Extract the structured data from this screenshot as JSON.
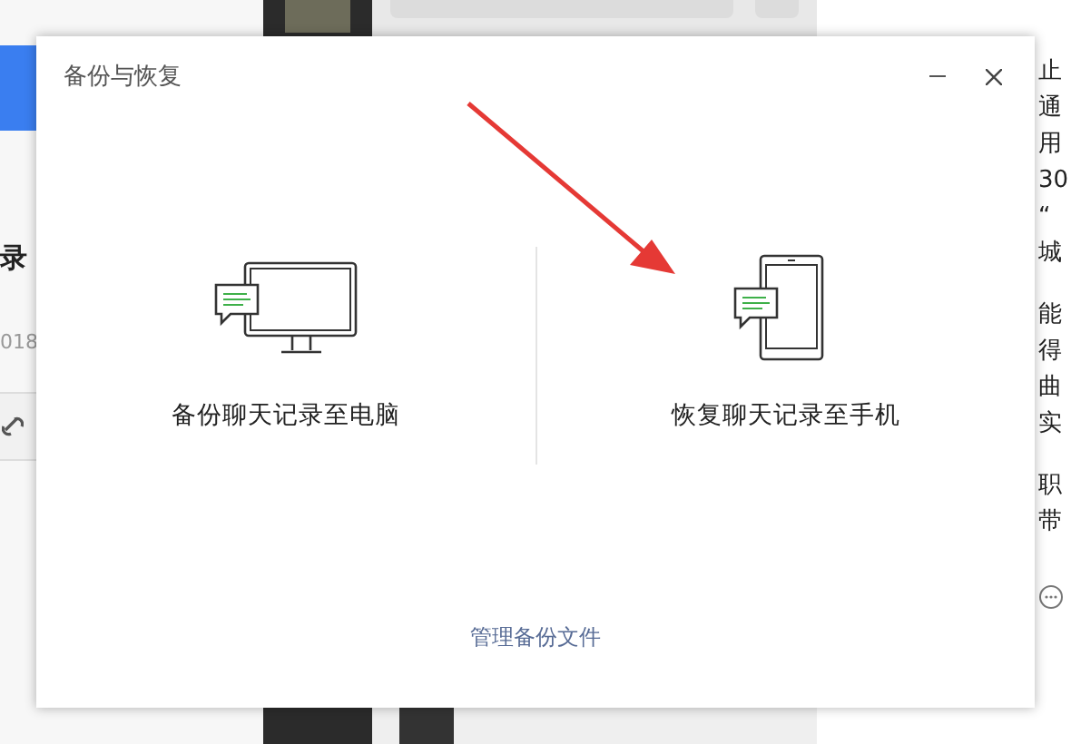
{
  "background": {
    "left_page": {
      "heading": "录",
      "date": "018"
    },
    "article_paragraphs": [
      [
        "止",
        "通",
        "用",
        "30",
        "“",
        "城"
      ],
      [
        "能",
        "得",
        "曲",
        "实"
      ],
      [
        "职",
        "带"
      ]
    ]
  },
  "dialog": {
    "title": "备份与恢复",
    "options": [
      {
        "kind": "computer",
        "label": "备份聊天记录至电脑"
      },
      {
        "kind": "phone",
        "label": "恢复聊天记录至手机"
      }
    ],
    "link": "管理备份文件"
  }
}
